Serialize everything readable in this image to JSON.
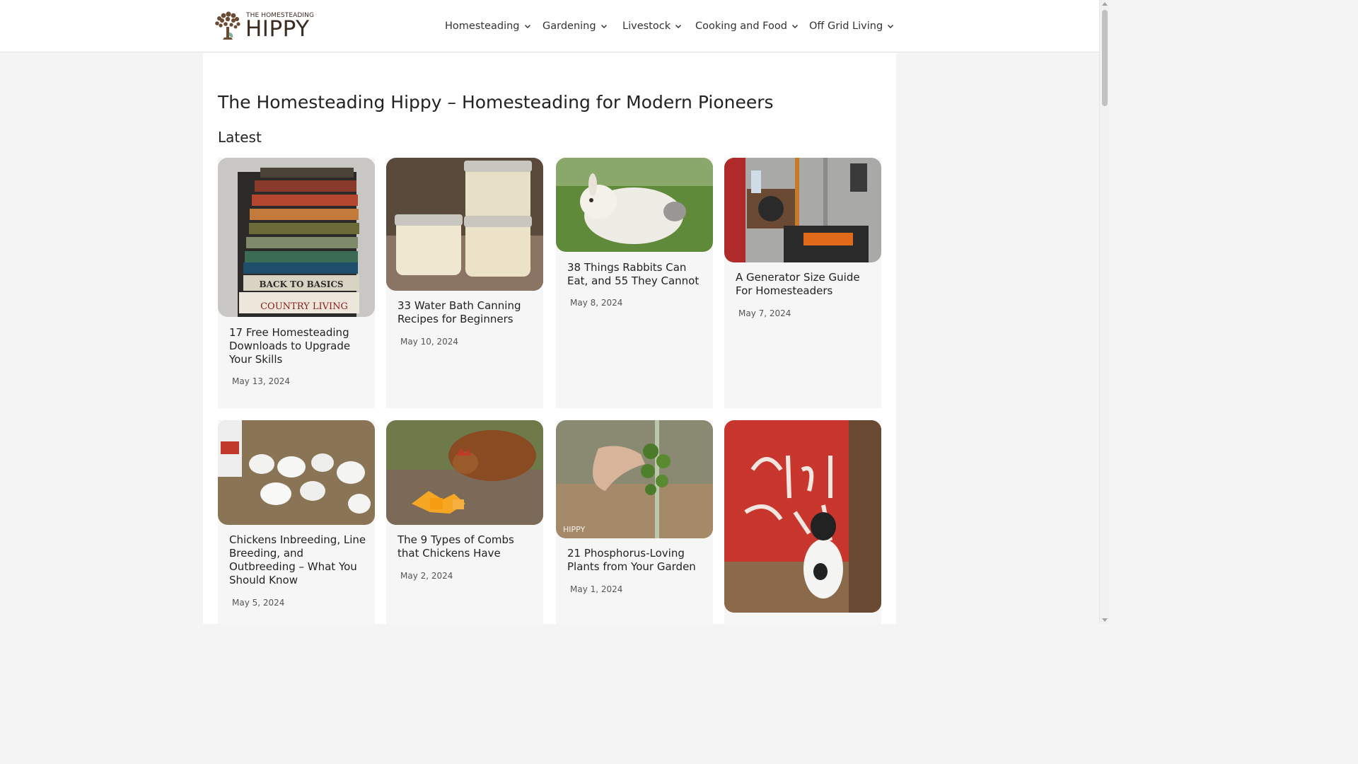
{
  "site": {
    "logo_small": "THE HOMESTEADING",
    "logo_big": "HIPPY"
  },
  "nav": [
    {
      "label": "Homesteading"
    },
    {
      "label": "Gardening"
    },
    {
      "label": "Livestock"
    },
    {
      "label": "Cooking and Food"
    },
    {
      "label": "Off Grid Living"
    }
  ],
  "page": {
    "title": "The Homesteading Hippy – Homesteading for Modern Pioneers",
    "section": "Latest"
  },
  "posts": [
    {
      "title": "17 Free Homesteading Downloads to Upgrade Your Skills",
      "date": "May 13, 2024",
      "image": "stack of homesteading books"
    },
    {
      "title": "33 Water Bath Canning Recipes for Beginners",
      "date": "May 10, 2024",
      "image": "canning jars"
    },
    {
      "title": "38 Things Rabbits Can Eat, and 55 They Cannot",
      "date": "May 8, 2024",
      "image": "white rabbit on grass"
    },
    {
      "title": "A Generator Size Guide For Homesteaders",
      "date": "May 7, 2024",
      "image": "generator in shed"
    },
    {
      "title": "Chickens Inbreeding, Line Breeding, and Outbreeding – What You Should Know",
      "date": "May 5, 2024",
      "image": "white chicks"
    },
    {
      "title": "The 9 Types of Combs that Chickens Have",
      "date": "May 2, 2024",
      "image": "hen eating squash"
    },
    {
      "title": "21 Phosphorus-Loving Plants from Your Garden",
      "date": "May 1, 2024",
      "image": "brussels sprouts stalk"
    },
    {
      "title": "",
      "date": "",
      "image": "goat shack"
    }
  ],
  "colors": {
    "accent_brown": "#3d2c22",
    "logo_green": "#7bb3a1"
  }
}
